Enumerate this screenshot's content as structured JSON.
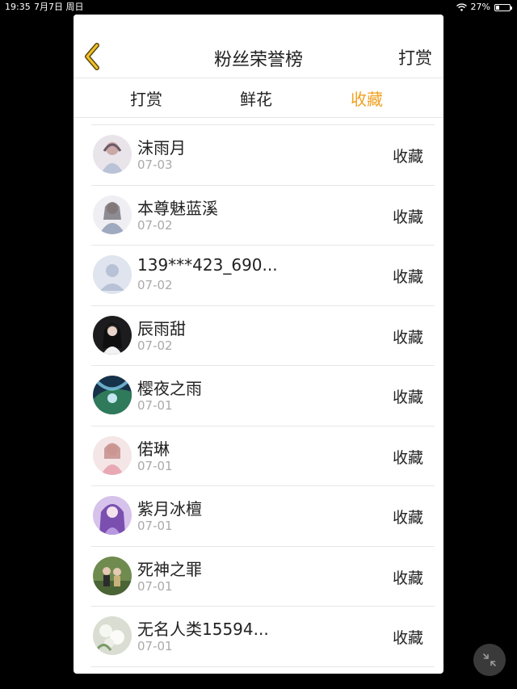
{
  "status_bar": {
    "time": "19:35",
    "date": "7月7日 周日",
    "battery_percent": "27%",
    "battery_level": 0.27,
    "wifi_icon": "wifi-icon",
    "battery_icon": "battery-icon"
  },
  "header": {
    "title": "粉丝荣誉榜",
    "action_label": "打赏",
    "back_icon": "chevron-left-icon",
    "accent_color": "#f0a020"
  },
  "tabs": [
    {
      "label": "打赏",
      "active": false
    },
    {
      "label": "鲜花",
      "active": false
    },
    {
      "label": "收藏",
      "active": true
    }
  ],
  "fans": [
    {
      "name": "沫雨月",
      "date": "07-03",
      "action": "收藏"
    },
    {
      "name": "本尊魅蓝溪",
      "date": "07-02",
      "action": "收藏"
    },
    {
      "name": "139***423_690...",
      "date": "07-02",
      "action": "收藏"
    },
    {
      "name": "辰雨甜",
      "date": "07-02",
      "action": "收藏"
    },
    {
      "name": "樱夜之雨",
      "date": "07-01",
      "action": "收藏"
    },
    {
      "name": "偌琳",
      "date": "07-01",
      "action": "收藏"
    },
    {
      "name": "紫月冰檀",
      "date": "07-01",
      "action": "收藏"
    },
    {
      "name": "死神之罪",
      "date": "07-01",
      "action": "收藏"
    },
    {
      "name": "无名人类15594...",
      "date": "07-01",
      "action": "收藏"
    }
  ],
  "floating_button": {
    "icon": "collapse-arrows-icon"
  }
}
